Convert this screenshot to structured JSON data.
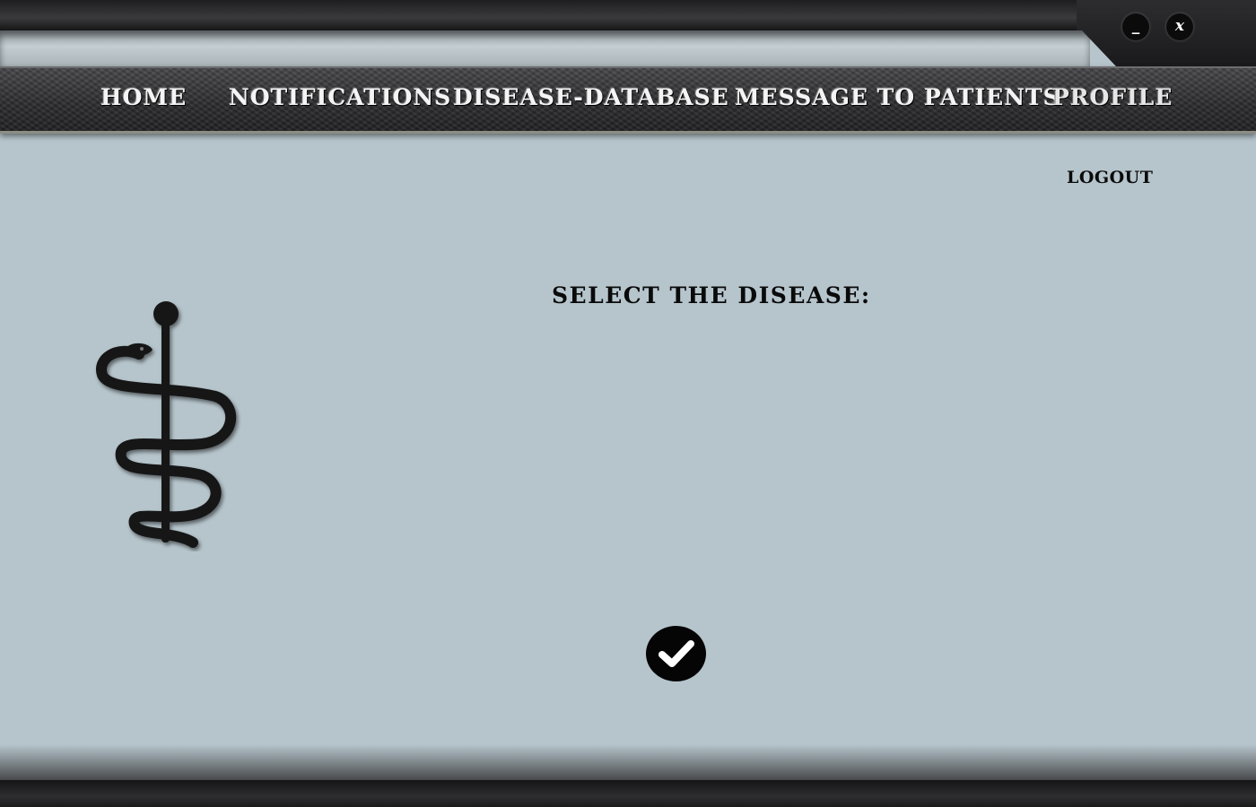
{
  "window": {
    "minimize_label": "_",
    "close_label": "x"
  },
  "nav": {
    "items": [
      {
        "label": "HOME"
      },
      {
        "label": "NOTIFICATIONS"
      },
      {
        "label": "DISEASE-DATABASE"
      },
      {
        "label": "MESSAGE TO PATIENTS"
      },
      {
        "label": "PROFILE"
      }
    ]
  },
  "logout_label": "LOGOUT",
  "main": {
    "heading": "SELECT THE DISEASE:"
  },
  "icons": {
    "logo": "rod-of-asclepius-icon",
    "confirm": "checkmark-icon"
  },
  "colors": {
    "background": "#b6c5cc",
    "nav_text": "#f4f4f4",
    "text": "#0a0a0a"
  }
}
